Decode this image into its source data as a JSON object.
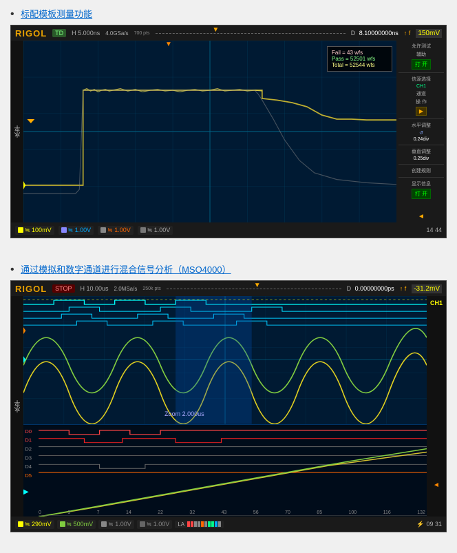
{
  "section1": {
    "title": "标配模板测量功能",
    "link": "标配模板测量功能"
  },
  "scope1": {
    "logo": "RIGOL",
    "mode": "TD",
    "timebase": "H  5.000ns",
    "sample_rate": "4.0GSa/s",
    "sample_rate2": "700 pts",
    "trigger_time": "8.10000000ns",
    "trigger_icon": "↑",
    "voltage": "150mV",
    "ch1_label": "水平",
    "info": {
      "fail": "Fail = 43 wfs",
      "pass": "Pass = 52501 wfs",
      "total": "Total = 52544 wfs"
    },
    "right_panel": {
      "pass_test_label": "允许测试",
      "assist_label": "辅助",
      "btn_open1": "打  开",
      "source_select_label": "信源选择",
      "ch_label": "CH1",
      "operate_label": "通道",
      "operate2_label": "操 作",
      "play_btn": "▶",
      "h_adjust_label": "水平调整",
      "h_val": "0.24div",
      "v_adjust_label": "垂直调整",
      "v_val": "0.25div",
      "create_rule_label": "创建规则",
      "show_info_label": "显示信息",
      "btn_open2": "打  开"
    },
    "bottom": {
      "ch1": "≒ 100mV",
      "ch2": "≒ 1.00V",
      "ch3": "≒ 1.00V",
      "ch4": "≒ 1.00V",
      "time": "14 44"
    }
  },
  "section2": {
    "title": "通过模拟和数字通道进行混合信号分析（MSO4000）",
    "link": "通过模拟和数字通道进行混合信号分析（MSO4000）"
  },
  "scope2": {
    "logo": "RIGOL",
    "mode": "STOP",
    "timebase": "H  10.00us",
    "sample_rate": "2.0MSa/s",
    "sample_rate2": "250k pts",
    "trigger_time": "0.00000000ps",
    "voltage": "-31.2mV",
    "zoom_label": "Zoom 2.000us",
    "ch1_right": "CH1",
    "ch_arrow": "◄",
    "bottom": {
      "ch1": "≒ 290mV",
      "ch2": "≒ 500mV",
      "ch3": "≒ 1.00V",
      "ch4": "≒ 1.00V",
      "la": "LA",
      "time": "09 31",
      "usb_icon": "⚡09:31"
    },
    "x_axis": [
      "0",
      "3",
      "7",
      "14",
      "22",
      "32",
      "43",
      "56",
      "70",
      "85",
      "100",
      "116",
      "132"
    ]
  }
}
